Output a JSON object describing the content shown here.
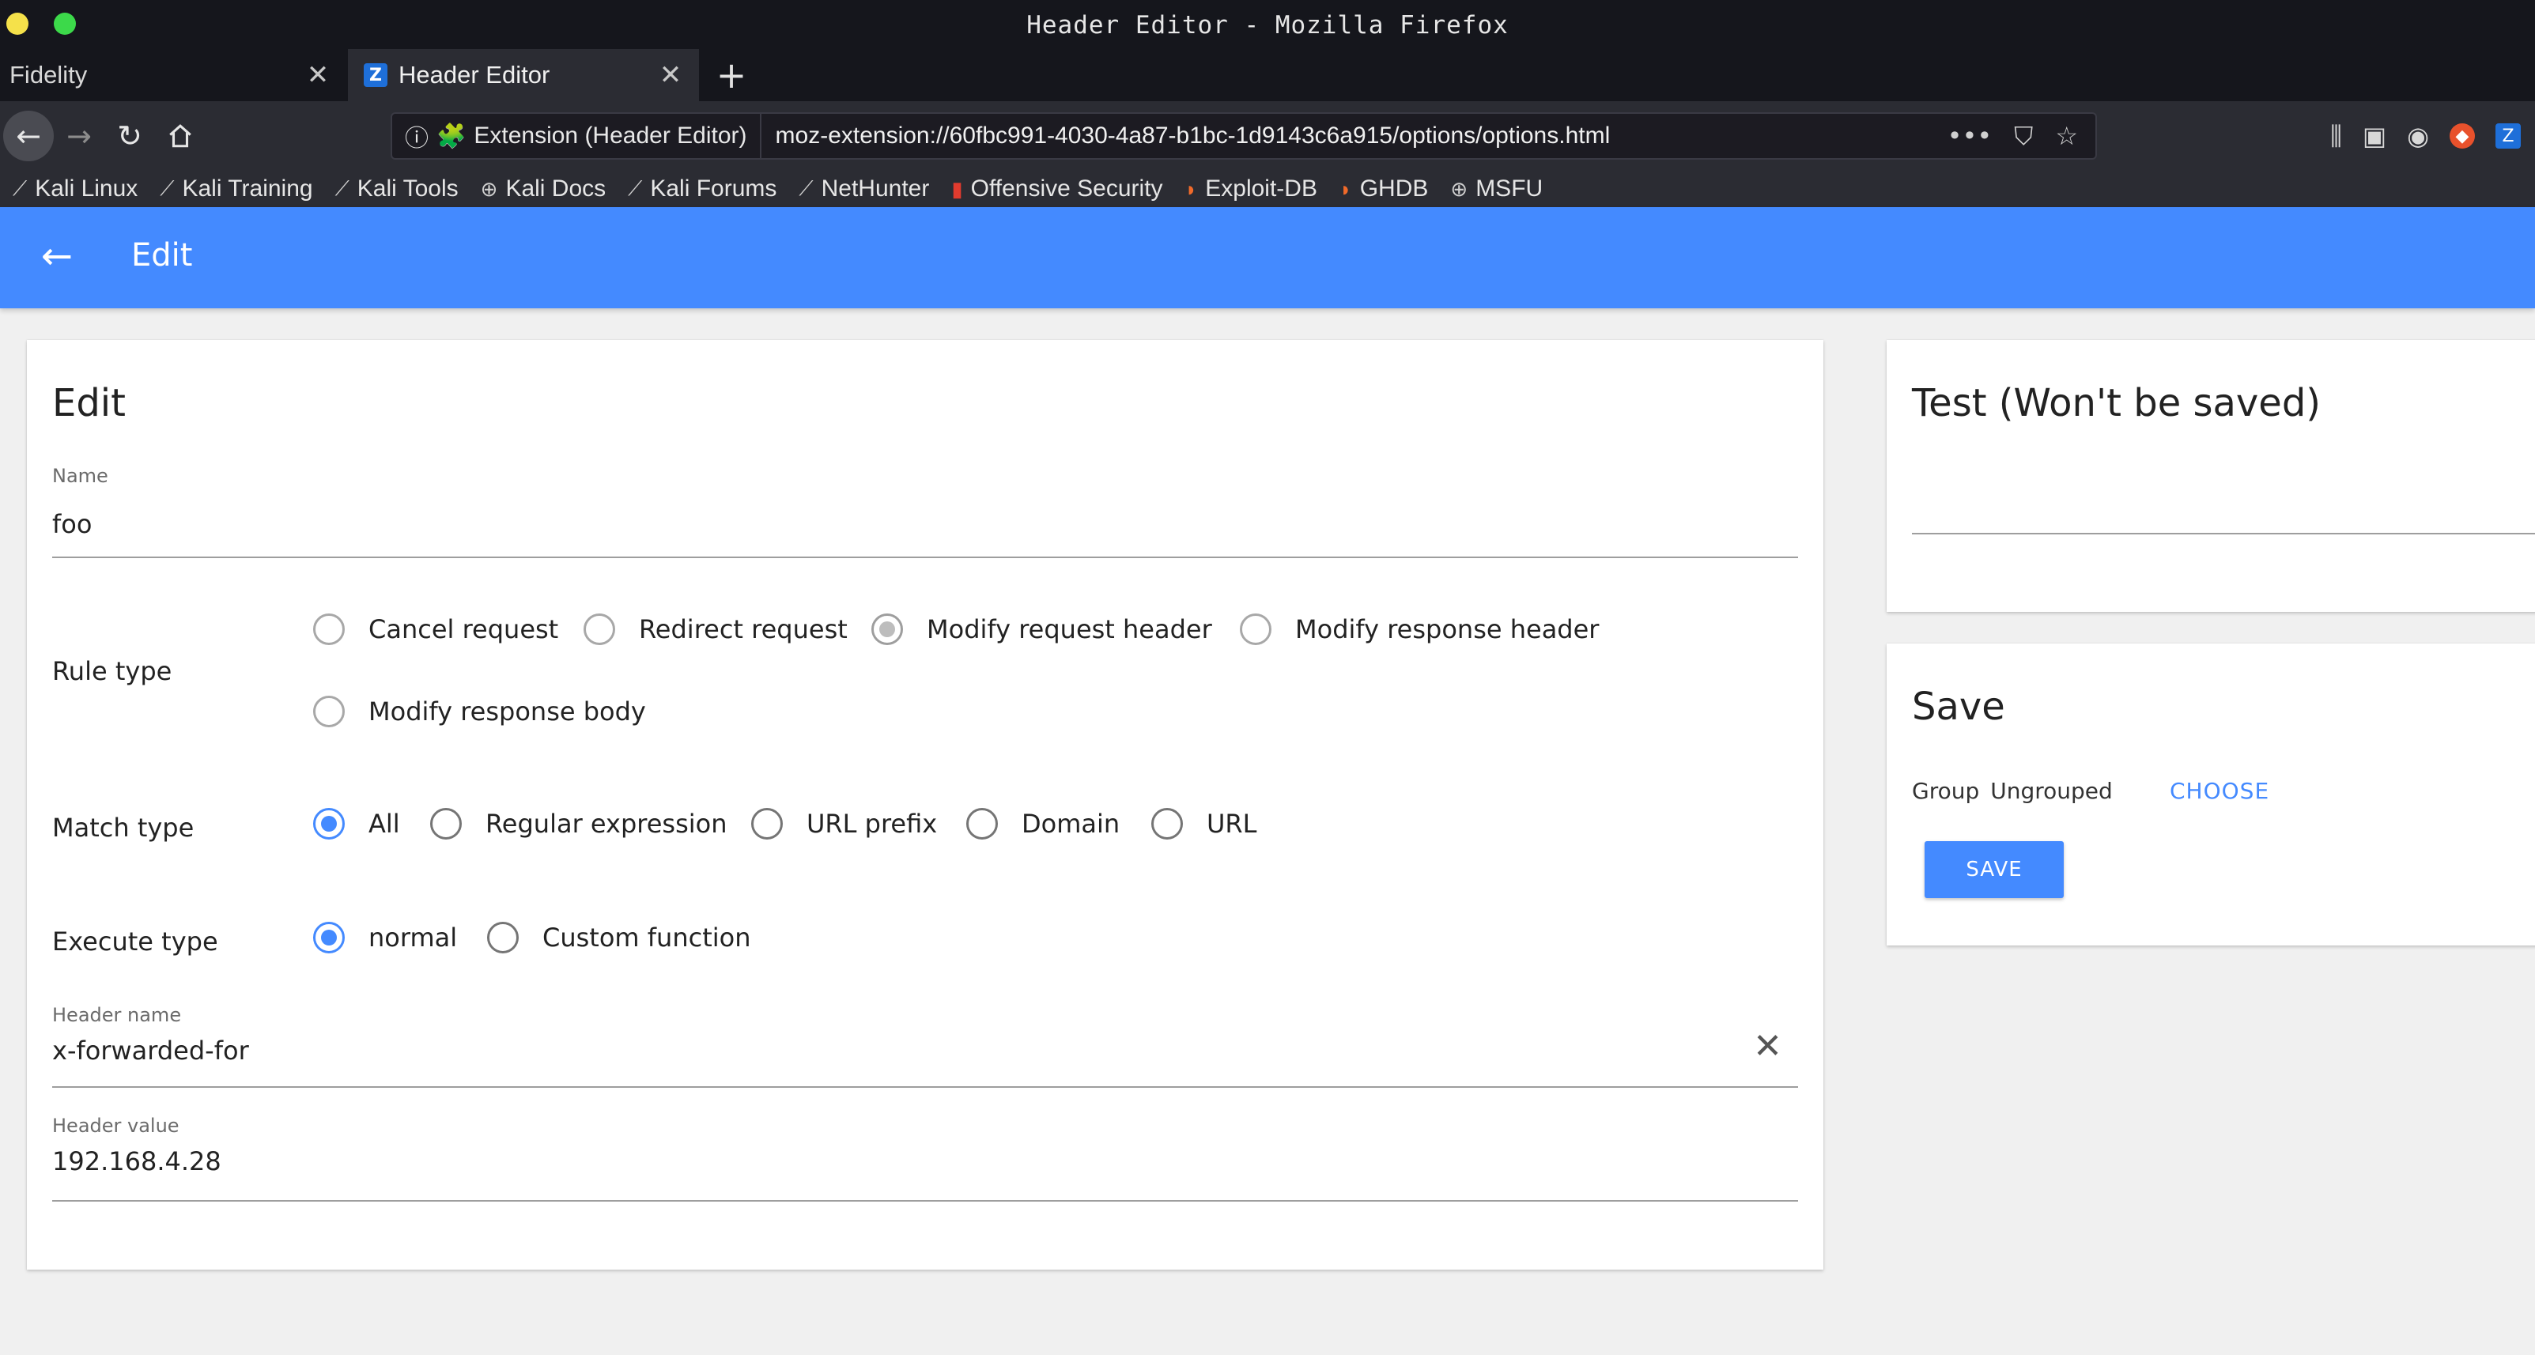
{
  "window": {
    "title": "Header Editor - Mozilla Firefox"
  },
  "tabs": [
    {
      "label": "Fidelity",
      "active": false
    },
    {
      "label": "Header Editor",
      "active": true
    }
  ],
  "urlbar": {
    "identity": "Extension (Header Editor)",
    "url": "moz-extension://60fbc991-4030-4a87-b1bc-1d9143c6a915/options/options.html"
  },
  "bookmarks": [
    {
      "label": "Kali Linux",
      "icon": "kali-dragon-icon"
    },
    {
      "label": "Kali Training",
      "icon": "kali-dragon-icon"
    },
    {
      "label": "Kali Tools",
      "icon": "kali-dragon-icon"
    },
    {
      "label": "Kali Docs",
      "icon": "globe-icon"
    },
    {
      "label": "Kali Forums",
      "icon": "kali-dragon-icon"
    },
    {
      "label": "NetHunter",
      "icon": "kali-dragon-icon"
    },
    {
      "label": "Offensive Security",
      "icon": "offsec-icon"
    },
    {
      "label": "Exploit-DB",
      "icon": "exploitdb-icon"
    },
    {
      "label": "GHDB",
      "icon": "exploitdb-icon"
    },
    {
      "label": "MSFU",
      "icon": "globe-icon"
    }
  ],
  "appbar": {
    "title": "Edit"
  },
  "edit": {
    "title": "Edit",
    "name_label": "Name",
    "name_value": "foo",
    "rule_type": {
      "label": "Rule type",
      "options": [
        "Cancel request",
        "Redirect request",
        "Modify request header",
        "Modify response header",
        "Modify response body"
      ],
      "selected": "Modify request header"
    },
    "match_type": {
      "label": "Match type",
      "options": [
        "All",
        "Regular expression",
        "URL prefix",
        "Domain",
        "URL"
      ],
      "selected": "All"
    },
    "execute_type": {
      "label": "Execute type",
      "options": [
        "normal",
        "Custom function"
      ],
      "selected": "normal"
    },
    "header_name_label": "Header name",
    "header_name_value": "x-forwarded-for",
    "header_value_label": "Header value",
    "header_value_value": "192.168.4.28"
  },
  "test": {
    "title": "Test (Won't be saved)",
    "value": ""
  },
  "save": {
    "title": "Save",
    "group_label": "Group",
    "group_value": "Ungrouped",
    "choose_label": "CHOOSE",
    "save_label": "SAVE"
  },
  "colors": {
    "accent": "#448aff",
    "chrome_dark": "#15161c",
    "toolbar": "#2b2c33"
  }
}
